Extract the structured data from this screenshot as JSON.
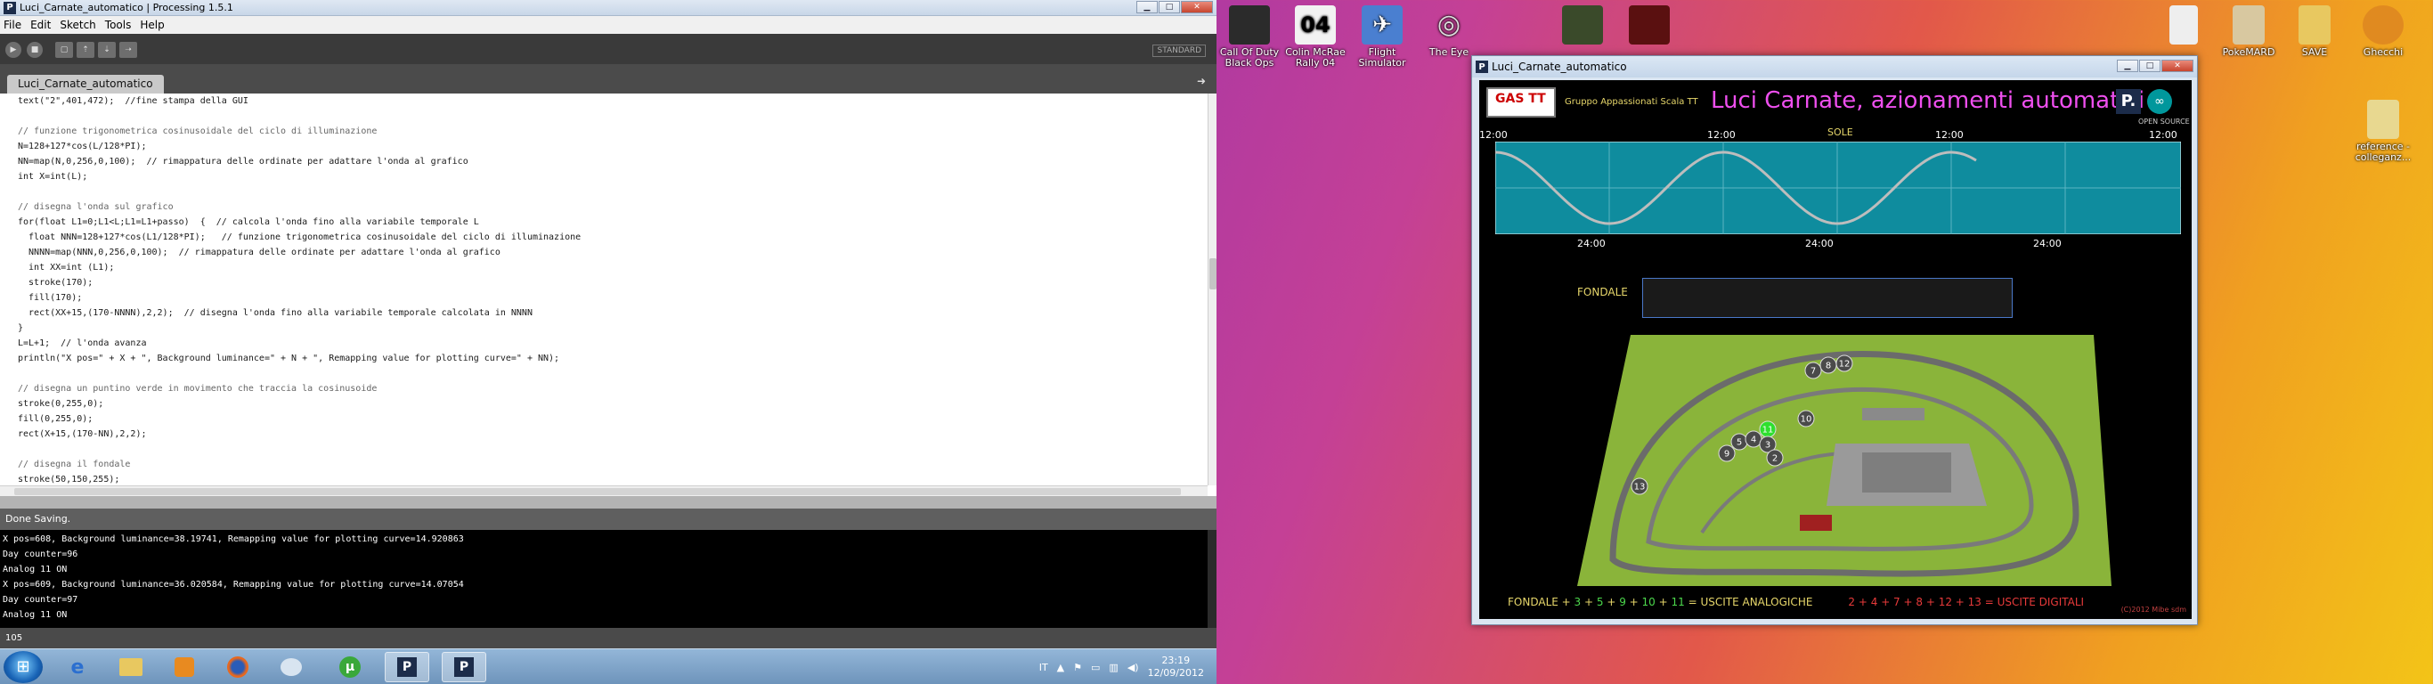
{
  "ide": {
    "title": "Luci_Carnate_automatico | Processing 1.5.1",
    "menu": [
      "File",
      "Edit",
      "Sketch",
      "Tools",
      "Help"
    ],
    "mode": "STANDARD",
    "tab_name": "Luci_Carnate_automatico",
    "code_lines": [
      "text(\"2\",401,472);  //fine stampa della GUI",
      "",
      "// funzione trigonometrica cosinusoidale del ciclo di illuminazione",
      "N=128+127*cos(L/128*PI);",
      "NN=map(N,0,256,0,100);  // rimappatura delle ordinate per adattare l'onda al grafico",
      "int X=int(L);",
      "",
      "// disegna l'onda sul grafico",
      "for(float L1=0;L1<L;L1=L1+passo)  {  // calcola l'onda fino alla variabile temporale L",
      "  float NNN=128+127*cos(L1/128*PI);   // funzione trigonometrica cosinusoidale del ciclo di illuminazione",
      "  NNNN=map(NNN,0,256,0,100);  // rimappatura delle ordinate per adattare l'onda al grafico",
      "  int XX=int (L1);",
      "  stroke(170);",
      "  fill(170);",
      "  rect(XX+15,(170-NNNN),2,2);  // disegna l'onda fino alla variabile temporale calcolata in NNNN",
      "}",
      "L=L+1;  // l'onda avanza",
      "println(\"X pos=\" + X + \", Background luminance=\" + N + \", Remapping value for plotting curve=\" + NN);",
      "",
      "// disegna un puntino verde in movimento che traccia la cosinusoide",
      "stroke(0,255,0);",
      "fill(0,255,0);",
      "rect(X+15,(170-NN),2,2);",
      "",
      "// disegna il fondale",
      "stroke(50,150,255);"
    ],
    "status": "Done Saving.",
    "console_lines": [
      "X pos=608, Background luminance=38.19741, Remapping value for plotting curve=14.920863",
      "Day counter=96",
      "Analog 11 ON",
      "X pos=609, Background luminance=36.020584, Remapping value for plotting curve=14.07054",
      "Day counter=97",
      "Analog 11 ON"
    ],
    "line_number": "105"
  },
  "taskbar": {
    "language": "IT",
    "time": "23:19",
    "date": "12/09/2012"
  },
  "desktop_icons": [
    {
      "label": "Call Of Duty Black Ops",
      "color": "#2b2b2b"
    },
    {
      "label": "Colin McRae Rally 04",
      "color": "#f2f2f2"
    },
    {
      "label": "Flight Simulator",
      "color": "#4a7fd0"
    },
    {
      "label": "The Eye",
      "color": "#6b6b6b"
    },
    {
      "label": "",
      "color": "#3a4a2a"
    },
    {
      "label": "",
      "color": "#5a1010"
    },
    {
      "label": "",
      "color": "#eeeeee"
    },
    {
      "label": "PokeMARD",
      "color": "#d8c8a0"
    },
    {
      "label": "SAVE",
      "color": "#e8c860"
    },
    {
      "label": "Ghecchi",
      "color": "#e08a20"
    },
    {
      "label": "reference - colleganz...",
      "color": "#e8d890"
    }
  ],
  "sketch": {
    "window_title": "Luci_Carnate_automatico",
    "logo_text": "GAS TT",
    "subtitle": "Gruppo Appassionati Scala TT",
    "title": "Luci Carnate, azionamenti automatici",
    "processing_logo": "P.",
    "arduino_logo": "∞",
    "open_source": "OPEN SOURCE",
    "sole_label": "SOLE",
    "top_ticks": [
      "12:00",
      "12:00",
      "12:00",
      "12:00"
    ],
    "bottom_ticks": [
      "24:00",
      "24:00",
      "24:00"
    ],
    "fondale_label": "FONDALE",
    "layout_numbers": [
      "7",
      "8",
      "12",
      "10",
      "11",
      "5",
      "4",
      "3",
      "9",
      "2",
      "13"
    ],
    "legend_analog": [
      "FONDALE",
      " + ",
      "3",
      " + ",
      "5",
      " + ",
      "9",
      " + ",
      "10",
      " + ",
      "11",
      " = ",
      "USCITE ANALOGICHE"
    ],
    "legend_digital": "2 + 4 + 7 + 8 + 12 + 13 = USCITE DIGITALI",
    "copyright": "(C)2012 Mibe sdm",
    "colors": {
      "title": "#ee4fee",
      "yellow": "#e6d66a",
      "green": "#4cd84c",
      "red": "#e83a3a",
      "plot_bg": "#0f8c9e"
    }
  }
}
